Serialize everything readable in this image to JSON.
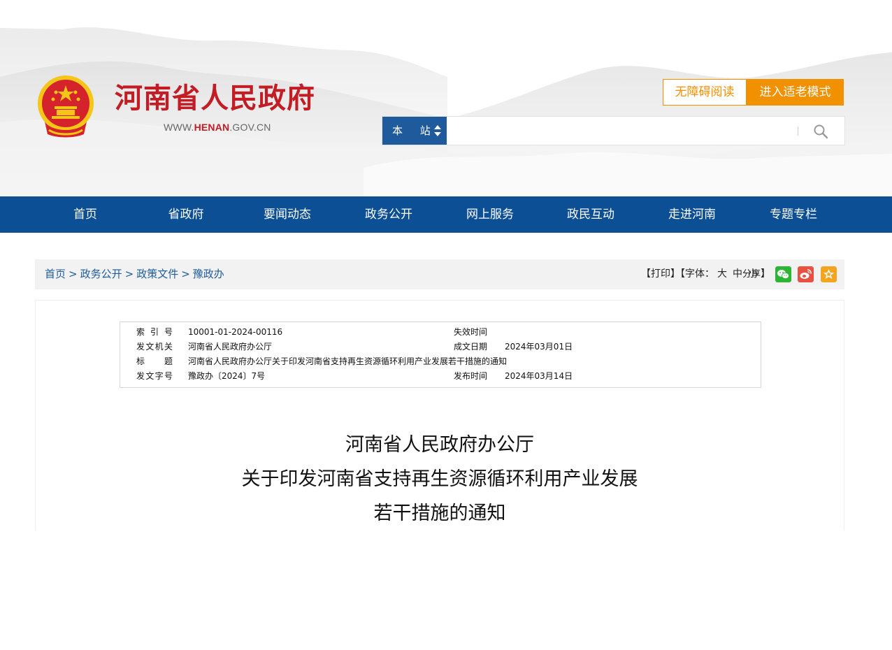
{
  "header": {
    "site_title": "河南省人民政府",
    "site_url_prefix": "WWW.",
    "site_url_highlight": "HENAN",
    "site_url_suffix": ".GOV.CN",
    "accessibility_label": "无障碍阅读",
    "elder_mode_label": "进入适老模式",
    "search": {
      "scope_label": "本 站",
      "placeholder": ""
    }
  },
  "nav": {
    "items": [
      "首页",
      "省政府",
      "要闻动态",
      "政务公开",
      "网上服务",
      "政民互动",
      "走进河南",
      "专题专栏"
    ]
  },
  "breadcrumb": {
    "items": [
      "首页",
      "政务公开",
      "政策文件",
      "豫政办"
    ],
    "separator": ">"
  },
  "tools": {
    "print_label": "【打印】",
    "font_label_open": "【字体：",
    "font_large": "大",
    "font_medium": "中",
    "font_small": "小",
    "font_label_close": "】",
    "share_label": "分享："
  },
  "meta": {
    "index_label": "索引号",
    "index_value": "10001-01-2024-00116",
    "expire_label": "失效时间",
    "expire_value": "",
    "issuer_label": "发文机关",
    "issuer_value": "河南省人民政府办公厅",
    "written_label": "成文日期",
    "written_value": "2024年03月01日",
    "title_label": "标题",
    "title_value": "河南省人民政府办公厅关于印发河南省支持再生资源循环利用产业发展若干措施的通知",
    "doc_no_label": "发文字号",
    "doc_no_value": "豫政办〔2024〕7号",
    "publish_label": "发布时间",
    "publish_value": "2024年03月14日"
  },
  "document": {
    "title_line1": "河南省人民政府办公厅",
    "title_line2": "关于印发河南省支持再生资源循环利用产业发展",
    "title_line3": "若干措施的通知"
  },
  "colors": {
    "brand_red": "#c21c25",
    "nav_blue": "#0c4f94",
    "accent_orange": "#f29100",
    "link_blue": "#1f5b9c"
  },
  "icons": {
    "emblem": "national-emblem-icon",
    "search": "search-icon",
    "wechat": "wechat-icon",
    "weibo": "weibo-icon",
    "favorite": "star-icon"
  }
}
